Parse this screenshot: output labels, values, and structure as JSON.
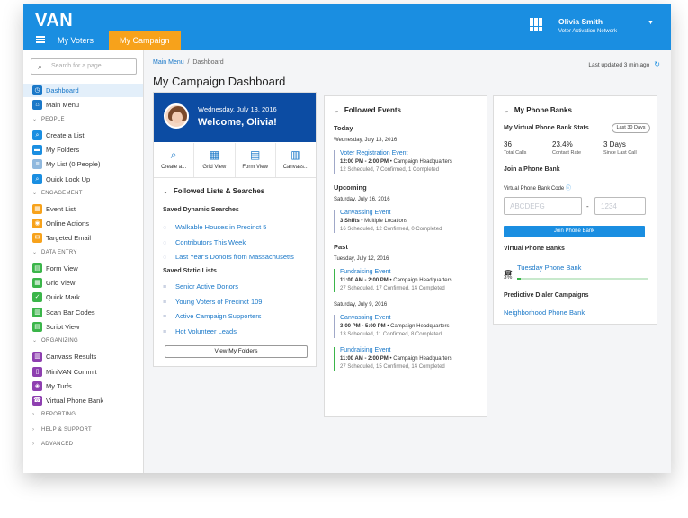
{
  "app": {
    "logo": "VAN",
    "nav": [
      "My Voters",
      "My Campaign"
    ],
    "user_name": "Olivia Smith",
    "user_role": "Voter Activation Network"
  },
  "sidebar": {
    "search_placeholder": "Search for a page",
    "top": [
      {
        "label": "Dashboard",
        "icon": "dashboard-icon",
        "color": "#1a78c8"
      },
      {
        "label": "Main Menu",
        "icon": "home-icon",
        "color": "#1a78c8"
      }
    ],
    "sections": [
      {
        "title": "PEOPLE",
        "items": [
          {
            "label": "Create a List",
            "icon": "search-icon",
            "color": "#1a8ee1"
          },
          {
            "label": "My Folders",
            "icon": "folder-icon",
            "color": "#1a8ee1"
          },
          {
            "label": "My List (0 People)",
            "icon": "list-icon",
            "color": "#8fb8de"
          },
          {
            "label": "Quick Look Up",
            "icon": "lookup-icon",
            "color": "#1a8ee1"
          }
        ]
      },
      {
        "title": "ENGAGEMENT",
        "items": [
          {
            "label": "Event List",
            "icon": "calendar-icon",
            "color": "#f7a21b"
          },
          {
            "label": "Online Actions",
            "icon": "online-icon",
            "color": "#f7a21b"
          },
          {
            "label": "Targeted Email",
            "icon": "email-icon",
            "color": "#f7a21b"
          }
        ]
      },
      {
        "title": "DATA ENTRY",
        "items": [
          {
            "label": "Form View",
            "icon": "form-icon",
            "color": "#3bb54a"
          },
          {
            "label": "Grid View",
            "icon": "grid-icon",
            "color": "#3bb54a"
          },
          {
            "label": "Quick Mark",
            "icon": "check-icon",
            "color": "#3bb54a"
          },
          {
            "label": "Scan Bar Codes",
            "icon": "barcode-icon",
            "color": "#3bb54a"
          },
          {
            "label": "Script View",
            "icon": "script-icon",
            "color": "#3bb54a"
          }
        ]
      },
      {
        "title": "ORGANIZING",
        "items": [
          {
            "label": "Canvass Results",
            "icon": "chart-icon",
            "color": "#8e3fb0"
          },
          {
            "label": "MiniVAN Commit",
            "icon": "phone-icon",
            "color": "#8e3fb0"
          },
          {
            "label": "My Turfs",
            "icon": "map-icon",
            "color": "#8e3fb0"
          },
          {
            "label": "Virtual Phone Bank",
            "icon": "phonebank-icon",
            "color": "#8e3fb0"
          }
        ]
      }
    ],
    "collapsed": [
      "REPORTING",
      "HELP & SUPPORT",
      "ADVANCED"
    ]
  },
  "main": {
    "breadcrumb": [
      "Main Menu",
      "Dashboard"
    ],
    "last_updated": "Last updated 3 min ago",
    "title": "My Campaign Dashboard"
  },
  "welcome": {
    "date": "Wednesday, July 13, 2016",
    "greeting": "Welcome, Olivia!"
  },
  "quick_actions": [
    {
      "label": "Create a...",
      "icon": "search-icon"
    },
    {
      "label": "Grid View",
      "icon": "grid-icon"
    },
    {
      "label": "Form View",
      "icon": "form-icon"
    },
    {
      "label": "Canvass...",
      "icon": "chart-icon"
    }
  ],
  "followed_lists": {
    "title": "Followed Lists & Searches",
    "dynamic_title": "Saved Dynamic Searches",
    "dynamic": [
      "Walkable Houses in Precinct 5",
      "Contributors This Week",
      "Last Year's Donors from Massachusetts"
    ],
    "static_title": "Saved Static Lists",
    "static": [
      "Senior Active Donors",
      "Young Voters of Precinct 109",
      "Active Campaign Supporters",
      "Hot Volunteer Leads"
    ],
    "button": "View My Folders"
  },
  "events": {
    "title": "Followed Events",
    "today": {
      "label": "Today",
      "date": "Wednesday, July 13, 2016",
      "items": [
        {
          "name": "Voter Registration Event",
          "time": "12:00 PM - 2:00 PM",
          "where": "Campaign Headquarters",
          "stats": "12 Scheduled, 7 Confirmed, 1 Completed"
        }
      ]
    },
    "upcoming": {
      "label": "Upcoming",
      "date": "Saturday, July 16, 2016",
      "items": [
        {
          "name": "Canvassing Event",
          "time": "3 Shifts",
          "where": "Multiple Locations",
          "stats": "16 Scheduled, 12 Confirmed, 0 Completed"
        }
      ]
    },
    "past": {
      "label": "Past",
      "groups": [
        {
          "date": "Tuesday, July 12, 2016",
          "items": [
            {
              "name": "Fundraising Event",
              "time": "11:00 AM - 2:00 PM",
              "where": "Campaign Headquarters",
              "stats": "27 Scheduled, 17 Confirmed, 14 Completed"
            }
          ]
        },
        {
          "date": "Saturday, July 9, 2016",
          "items": [
            {
              "name": "Canvassing Event",
              "time": "3:00 PM - 5:00 PM",
              "where": "Campaign Headquarters",
              "stats": "13 Scheduled, 11 Confirmed, 8 Completed"
            },
            {
              "name": "Fundraising Event",
              "time": "11:00 AM - 2:00 PM",
              "where": "Campaign Headquarters",
              "stats": "27 Scheduled, 15 Confirmed, 14 Completed"
            }
          ]
        }
      ]
    }
  },
  "phone_banks": {
    "title": "My Phone Banks",
    "stats_title": "My Virtual Phone Bank Stats",
    "range_badge": "Last 30 Days",
    "stats": [
      {
        "value": "36",
        "label": "Total Calls"
      },
      {
        "value": "23.4%",
        "label": "Contact Rate"
      },
      {
        "value": "3 Days",
        "label": "Since Last Call"
      }
    ],
    "join_title": "Join a Phone Bank",
    "code_label": "Virtual Phone Bank Code",
    "code_placeholder": "ABCDEFG",
    "pin_placeholder": "1234",
    "join_button": "Join Phone Bank",
    "virtual_title": "Virtual Phone Banks",
    "vpb_name": "Tuesday Phone Bank",
    "vpb_progress_label": "3%",
    "vpb_progress": 0.03,
    "dialer_title": "Predictive Dialer Campaigns",
    "dialer_link": "Neighborhood Phone Bank"
  }
}
